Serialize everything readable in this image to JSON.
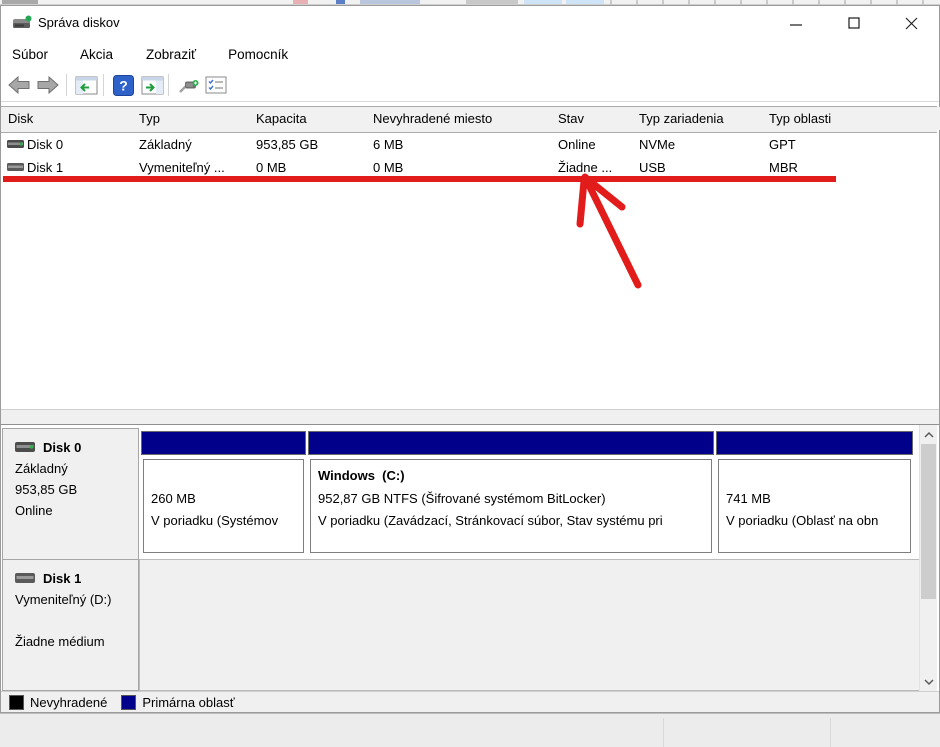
{
  "window": {
    "title": "Správa diskov"
  },
  "menu": {
    "items": [
      "Súbor",
      "Akcia",
      "Zobraziť",
      "Pomocník"
    ]
  },
  "toolbar": {
    "icons": [
      "back-icon",
      "forward-icon",
      "console-tree-icon",
      "help-icon",
      "action-pane-icon",
      "rescan-icon",
      "properties-list-icon"
    ]
  },
  "table": {
    "columns": [
      "Disk",
      "Typ",
      "Kapacita",
      "Nevyhradené miesto",
      "Stav",
      "Typ zariadenia",
      "Typ oblasti"
    ],
    "rows": [
      {
        "disk": "Disk 0",
        "typ": "Základný",
        "kapacita": "953,85 GB",
        "nevyhradene": "6 MB",
        "stav": "Online",
        "zariadenie": "NVMe",
        "oblast": "GPT"
      },
      {
        "disk": "Disk 1",
        "typ": "Vymeniteľný ...",
        "kapacita": "0 MB",
        "nevyhradene": "0 MB",
        "stav": "Žiadne ...",
        "zariadenie": "USB",
        "oblast": "MBR"
      }
    ]
  },
  "disk0": {
    "name": "Disk 0",
    "type": "Základný",
    "size": "953,85 GB",
    "status": "Online",
    "partitions": [
      {
        "title": "",
        "line1": "260 MB",
        "line2": "V poriadku (Systémov"
      },
      {
        "title": "Windows  (C:)",
        "line1": "952,87 GB NTFS (Šifrované systémom BitLocker)",
        "line2": "V poriadku (Zavádzací, Stránkovací súbor, Stav systému pri"
      },
      {
        "title": "",
        "line1": "741 MB",
        "line2": "V poriadku (Oblasť na obn"
      }
    ]
  },
  "disk1": {
    "name": "Disk 1",
    "type": "Vymeniteľný (D:)",
    "status": "Žiadne médium"
  },
  "legend": {
    "items": [
      {
        "label": "Nevyhradené",
        "color": "#000000"
      },
      {
        "label": "Primárna oblasť",
        "color": "#00008b"
      }
    ]
  },
  "colors": {
    "partition_bar": "#00008b",
    "annotation_red": "#e21b1b"
  }
}
